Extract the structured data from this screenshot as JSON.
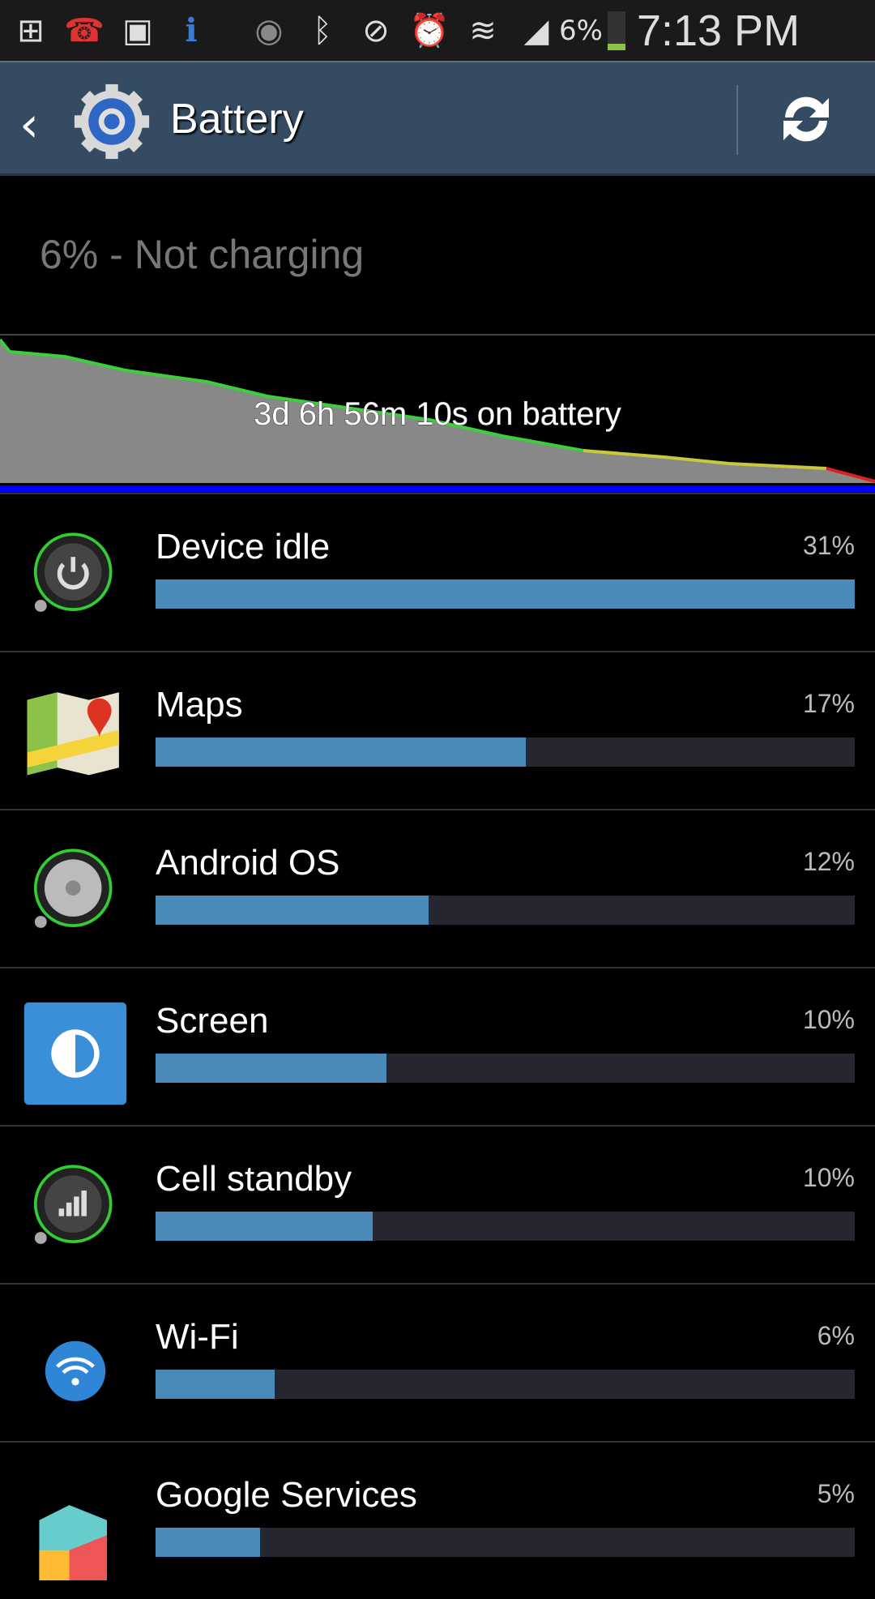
{
  "status_bar": {
    "icons": [
      "add-notification-icon",
      "missed-call-icon",
      "image-icon",
      "info-icon",
      "smart-stay-eye-icon",
      "bluetooth-icon",
      "mute-icon",
      "alarm-icon",
      "wifi-icon",
      "signal-icon"
    ],
    "battery_percent": "6%",
    "time": "7:13 PM"
  },
  "action_bar": {
    "title": "Battery",
    "back_icon": "chevron-left-icon",
    "app_icon": "settings-gear-icon",
    "refresh_icon": "refresh-icon"
  },
  "summary": "6% - Not charging",
  "graph": {
    "label": "3d 6h 56m 10s on battery",
    "colors": {
      "fill": "#888888",
      "high": "#3ccf3c",
      "mid": "#c8c83c",
      "low": "#e02020",
      "baseline": "#0000ff"
    }
  },
  "items": [
    {
      "name": "Device idle",
      "percent": "31%",
      "fill": 1.0,
      "icon": "power-icon"
    },
    {
      "name": "Maps",
      "percent": "17%",
      "fill": 0.53,
      "icon": "maps-icon"
    },
    {
      "name": "Android OS",
      "percent": "12%",
      "fill": 0.39,
      "icon": "android-os-icon"
    },
    {
      "name": "Screen",
      "percent": "10%",
      "fill": 0.33,
      "icon": "screen-brightness-icon"
    },
    {
      "name": "Cell standby",
      "percent": "10%",
      "fill": 0.31,
      "icon": "cell-signal-icon"
    },
    {
      "name": "Wi-Fi",
      "percent": "6%",
      "fill": 0.17,
      "icon": "wifi-icon"
    },
    {
      "name": "Google Services",
      "percent": "5%",
      "fill": 0.15,
      "icon": "google-services-icon"
    }
  ],
  "colors": {
    "accent": "#4a8ab9",
    "action_bar": "#354b62"
  }
}
